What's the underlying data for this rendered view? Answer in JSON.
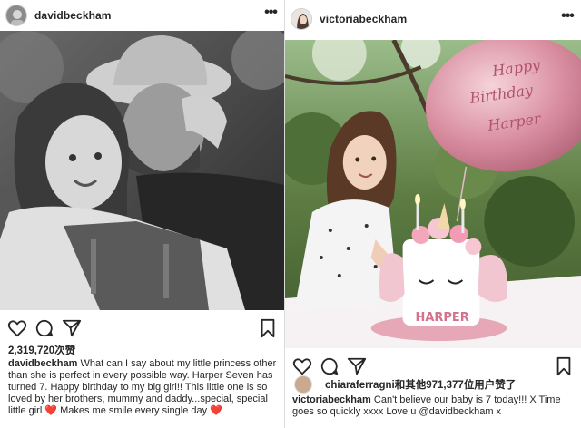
{
  "left_post": {
    "username": "davidbeckham",
    "more_label": "•••",
    "likes": "2,319,720次赞",
    "caption_user": "davidbeckham",
    "caption_text": " What can I say about my little princess other than she is perfect in every possible way. Harper Seven has turned 7. Happy birthday to my big girl!! This little one is so loved by her brothers, mummy and daddy...special, special little girl ",
    "caption_emoji": "❤️",
    "caption_end": " Makes me smile every single day ",
    "caption_emoji2": "❤️",
    "icons": [
      "heart-icon",
      "comment-icon",
      "share-icon",
      "bookmark-icon"
    ]
  },
  "right_post": {
    "username": "victoriabeckham",
    "more_label": "•••",
    "liked_by_user": "chiaraferragni",
    "liked_by_rest": "和其他971,377位用户赞了",
    "caption_user": "victoriabeckham",
    "caption_text": " Can't believe our baby is 7 today!!! X Time goes so quickly xxxx Love u @davidbeckham x",
    "balloon_text": "Happy Birthday Harper",
    "cake_text": "HARPER",
    "icons": [
      "heart-icon",
      "comment-icon",
      "share-icon",
      "bookmark-icon"
    ]
  },
  "colors": {
    "text": "#262626",
    "divider": "#dbdbdb",
    "heart": "#e0245e",
    "balloon": "#d98ea0"
  }
}
